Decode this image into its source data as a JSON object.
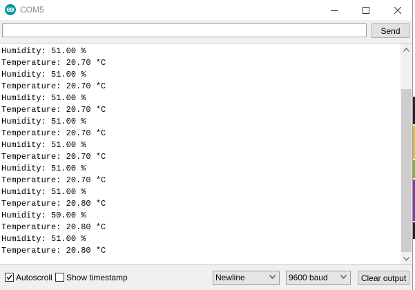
{
  "window": {
    "title": "COM5",
    "icon": "arduino-logo-icon",
    "controls": [
      "minimize-icon",
      "maximize-icon",
      "close-icon"
    ]
  },
  "send": {
    "input_value": "",
    "button_label": "Send"
  },
  "output": {
    "lines": [
      "Humidity: 51.00 %",
      "Temperature: 20.70 *C",
      "Humidity: 51.00 %",
      "Temperature: 20.70 *C",
      "Humidity: 51.00 %",
      "Temperature: 20.70 *C",
      "Humidity: 51.00 %",
      "Temperature: 20.70 *C",
      "Humidity: 51.00 %",
      "Temperature: 20.70 *C",
      "Humidity: 51.00 %",
      "Temperature: 20.70 *C",
      "Humidity: 51.00 %",
      "Temperature: 20.80 *C",
      "Humidity: 50.00 %",
      "Temperature: 20.80 *C",
      "Humidity: 51.00 %",
      "Temperature: 20.80 *C"
    ]
  },
  "footer": {
    "autoscroll": {
      "label": "Autoscroll",
      "checked": true
    },
    "timestamp": {
      "label": "Show timestamp",
      "checked": false
    },
    "line_ending": "Newline",
    "baud_rate": "9600 baud",
    "clear_label": "Clear output"
  },
  "colors": {
    "icon_teal": "#00979d",
    "chrome_bg": "#f0f0f0",
    "scroll_thumb": "#cdcdcd"
  }
}
